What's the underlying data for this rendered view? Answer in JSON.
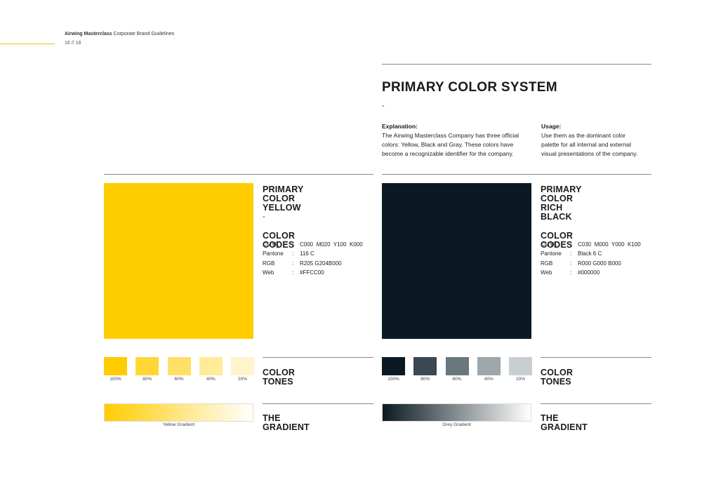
{
  "header": {
    "brand": "Airwing Masterclass",
    "doc_title": "Corporate Brand Guidelines",
    "page": "16 // 18"
  },
  "section": {
    "title": "PRIMARY COLOR SYSTEM",
    "dash": "-",
    "explanation_label": "Explanation:",
    "explanation_lines": [
      "The Airwing Masterclass Company has three official",
      "colors: Yellow, Black and Gray. These colors have",
      "become a recognizable identifier for the company."
    ],
    "usage_label": "Usage:",
    "usage_lines": [
      "Use them as the dominant color",
      "palette for all internal and external",
      "visual presentations of the company."
    ]
  },
  "colors": [
    {
      "title_line1": "PRIMARY COLOR",
      "title_line2": "YELLOW",
      "dash": "-",
      "codes_title": "COLOR CODES",
      "swatch_color": "#FFCC00",
      "codes": [
        {
          "key": "CMYK",
          "sep": ":",
          "value": "C000  M020  Y100  K000"
        },
        {
          "key": "Pantone",
          "sep": ":",
          "value": "116 C"
        },
        {
          "key": "RGB",
          "sep": ":",
          "value": "R205 G204B000"
        },
        {
          "key": "Web",
          "sep": ":",
          "value": "#FFCC00"
        }
      ],
      "tones_title": "COLOR TONES",
      "tones": [
        {
          "label": "100%",
          "color": "#FFCC00"
        },
        {
          "label": "80%",
          "color": "#FFD633"
        },
        {
          "label": "60%",
          "color": "#FFE066"
        },
        {
          "label": "40%",
          "color": "#FFEB99"
        },
        {
          "label": "20%",
          "color": "#FFF5CC"
        }
      ],
      "gradient_title": "THE GRADIENT",
      "gradient_label": "Yellow Gradient",
      "gradient_from": "#FFCC00",
      "gradient_to": "#FFFFFF"
    },
    {
      "title_line1": "PRIMARY COLOR",
      "title_line2": "RICH BLACK",
      "dash": "-",
      "codes_title": "COLOR CODES",
      "swatch_color": "#0B1A22",
      "codes": [
        {
          "key": "CMYK",
          "sep": ":",
          "value": "C030  M000  Y000  K100"
        },
        {
          "key": "Pantone",
          "sep": ":",
          "value": "Black 6 C"
        },
        {
          "key": "RGB",
          "sep": ":",
          "value": "R000 G000 B000"
        },
        {
          "key": "Web",
          "sep": ":",
          "value": "#000000"
        }
      ],
      "tones_title": "COLOR TONES",
      "tones": [
        {
          "label": "100%",
          "color": "#0B1A22"
        },
        {
          "label": "80%",
          "color": "#3B4851"
        },
        {
          "label": "60%",
          "color": "#6B777E"
        },
        {
          "label": "40%",
          "color": "#9DA6AB"
        },
        {
          "label": "20%",
          "color": "#C9CED1"
        }
      ],
      "gradient_title": "THE GRADIENT",
      "gradient_label": "Grey Gradient",
      "gradient_from": "#0B1A22",
      "gradient_to": "#FFFFFF"
    }
  ]
}
